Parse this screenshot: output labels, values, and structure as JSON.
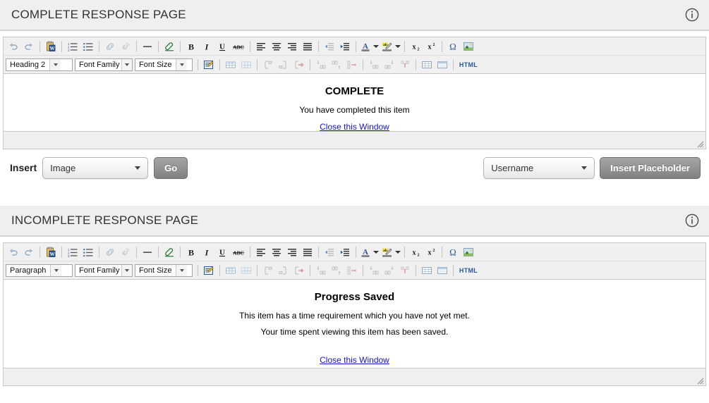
{
  "colors": {
    "header_bg": "#efefef",
    "toolbar_bg": "#f0f0f0",
    "link": "#1414cc",
    "button_gray": "#949494",
    "border": "#c8c8c8"
  },
  "panels": [
    {
      "title": "COMPLETE RESPONSE PAGE",
      "info_icon": "info-circle-icon",
      "editor": {
        "format_select": "Heading 2",
        "font_family_select": "Font Family",
        "font_size_select": "Font Size",
        "toolbar_row1": [
          {
            "name": "undo-icon",
            "glyph": "↶",
            "title": "Undo"
          },
          {
            "name": "redo-icon",
            "glyph": "↷",
            "title": "Redo"
          },
          {
            "name": "separator",
            "glyph": "",
            "title": ""
          },
          {
            "name": "paste-from-word-icon",
            "glyph": "",
            "title": "Paste from Word"
          },
          {
            "name": "separator",
            "glyph": "",
            "title": ""
          },
          {
            "name": "ordered-list-icon",
            "glyph": "",
            "title": "Numbered list"
          },
          {
            "name": "unordered-list-icon",
            "glyph": "",
            "title": "Bulleted list"
          },
          {
            "name": "separator",
            "glyph": "",
            "title": ""
          },
          {
            "name": "insert-link-icon",
            "glyph": "",
            "title": "Insert link"
          },
          {
            "name": "unlink-icon",
            "glyph": "",
            "title": "Unlink"
          },
          {
            "name": "separator",
            "glyph": "",
            "title": ""
          },
          {
            "name": "horizontal-rule-icon",
            "glyph": "—",
            "title": "Horizontal rule"
          },
          {
            "name": "separator",
            "glyph": "",
            "title": ""
          },
          {
            "name": "remove-format-icon",
            "glyph": "",
            "title": "Remove formatting"
          },
          {
            "name": "separator",
            "glyph": "",
            "title": ""
          },
          {
            "name": "bold-icon",
            "glyph": "B",
            "title": "Bold"
          },
          {
            "name": "italic-icon",
            "glyph": "I",
            "title": "Italic"
          },
          {
            "name": "underline-icon",
            "glyph": "U",
            "title": "Underline"
          },
          {
            "name": "strikethrough-icon",
            "glyph": "ABC",
            "title": "Strikethrough"
          },
          {
            "name": "separator",
            "glyph": "",
            "title": ""
          },
          {
            "name": "align-left-icon",
            "glyph": "",
            "title": "Align left"
          },
          {
            "name": "align-center-icon",
            "glyph": "",
            "title": "Align center"
          },
          {
            "name": "align-right-icon",
            "glyph": "",
            "title": "Align right"
          },
          {
            "name": "align-justify-icon",
            "glyph": "",
            "title": "Justify"
          },
          {
            "name": "separator",
            "glyph": "",
            "title": ""
          },
          {
            "name": "outdent-icon",
            "glyph": "",
            "title": "Outdent"
          },
          {
            "name": "indent-icon",
            "glyph": "",
            "title": "Indent"
          },
          {
            "name": "separator",
            "glyph": "",
            "title": ""
          },
          {
            "name": "text-color-icon",
            "glyph": "A",
            "title": "Text color"
          },
          {
            "name": "text-color-dropdown-icon",
            "glyph": "",
            "title": "Select text color"
          },
          {
            "name": "background-color-icon",
            "glyph": "",
            "title": "Background color"
          },
          {
            "name": "background-color-dropdown-icon",
            "glyph": "",
            "title": "Select background color"
          },
          {
            "name": "separator",
            "glyph": "",
            "title": ""
          },
          {
            "name": "subscript-icon",
            "glyph": "",
            "title": "Subscript"
          },
          {
            "name": "superscript-icon",
            "glyph": "",
            "title": "Superscript"
          },
          {
            "name": "separator",
            "glyph": "",
            "title": ""
          },
          {
            "name": "special-character-icon",
            "glyph": "Ω",
            "title": "Insert special character"
          },
          {
            "name": "insert-image-icon",
            "glyph": "",
            "title": "Insert image"
          }
        ],
        "toolbar_row2": [
          {
            "name": "edit-html-source-icon",
            "title": "Edit source"
          },
          {
            "name": "separator",
            "title": ""
          },
          {
            "name": "insert-table-icon",
            "title": "Insert table"
          },
          {
            "name": "table-properties-icon",
            "title": "Table properties"
          },
          {
            "name": "separator",
            "title": ""
          },
          {
            "name": "delete-table-icon",
            "title": "Delete table"
          },
          {
            "name": "table-cell-properties-icon",
            "title": "Cell properties"
          },
          {
            "name": "merge-cells-icon",
            "title": "Merge cells"
          },
          {
            "name": "separator",
            "title": ""
          },
          {
            "name": "insert-row-before-icon",
            "title": "Insert row before"
          },
          {
            "name": "insert-row-after-icon",
            "title": "Insert row after"
          },
          {
            "name": "delete-row-icon",
            "title": "Delete row"
          },
          {
            "name": "separator",
            "title": ""
          },
          {
            "name": "insert-column-before-icon",
            "title": "Insert column before"
          },
          {
            "name": "insert-column-after-icon",
            "title": "Insert column after"
          },
          {
            "name": "separator",
            "title": ""
          },
          {
            "name": "html-source-label",
            "title": "HTML"
          }
        ],
        "html_label": "HTML",
        "content": {
          "heading": "COMPLETE",
          "paragraphs": [
            "You have completed this item"
          ],
          "link": "Close this Window"
        }
      },
      "insert_bar": {
        "insert_label": "Insert",
        "type_select": "Image",
        "go_button": "Go",
        "placeholder_select": "Username",
        "placeholder_button": "Insert Placeholder"
      }
    },
    {
      "title": "INCOMPLETE RESPONSE PAGE",
      "info_icon": "info-circle-icon",
      "editor": {
        "format_select": "Paragraph",
        "font_family_select": "Font Family",
        "font_size_select": "Font Size",
        "html_label": "HTML",
        "content": {
          "heading": "Progress Saved",
          "paragraphs": [
            "This item has a time requirement which you have not yet met.",
            "Your time spent viewing this item has been saved."
          ],
          "link": "Close this Window"
        }
      }
    }
  ]
}
